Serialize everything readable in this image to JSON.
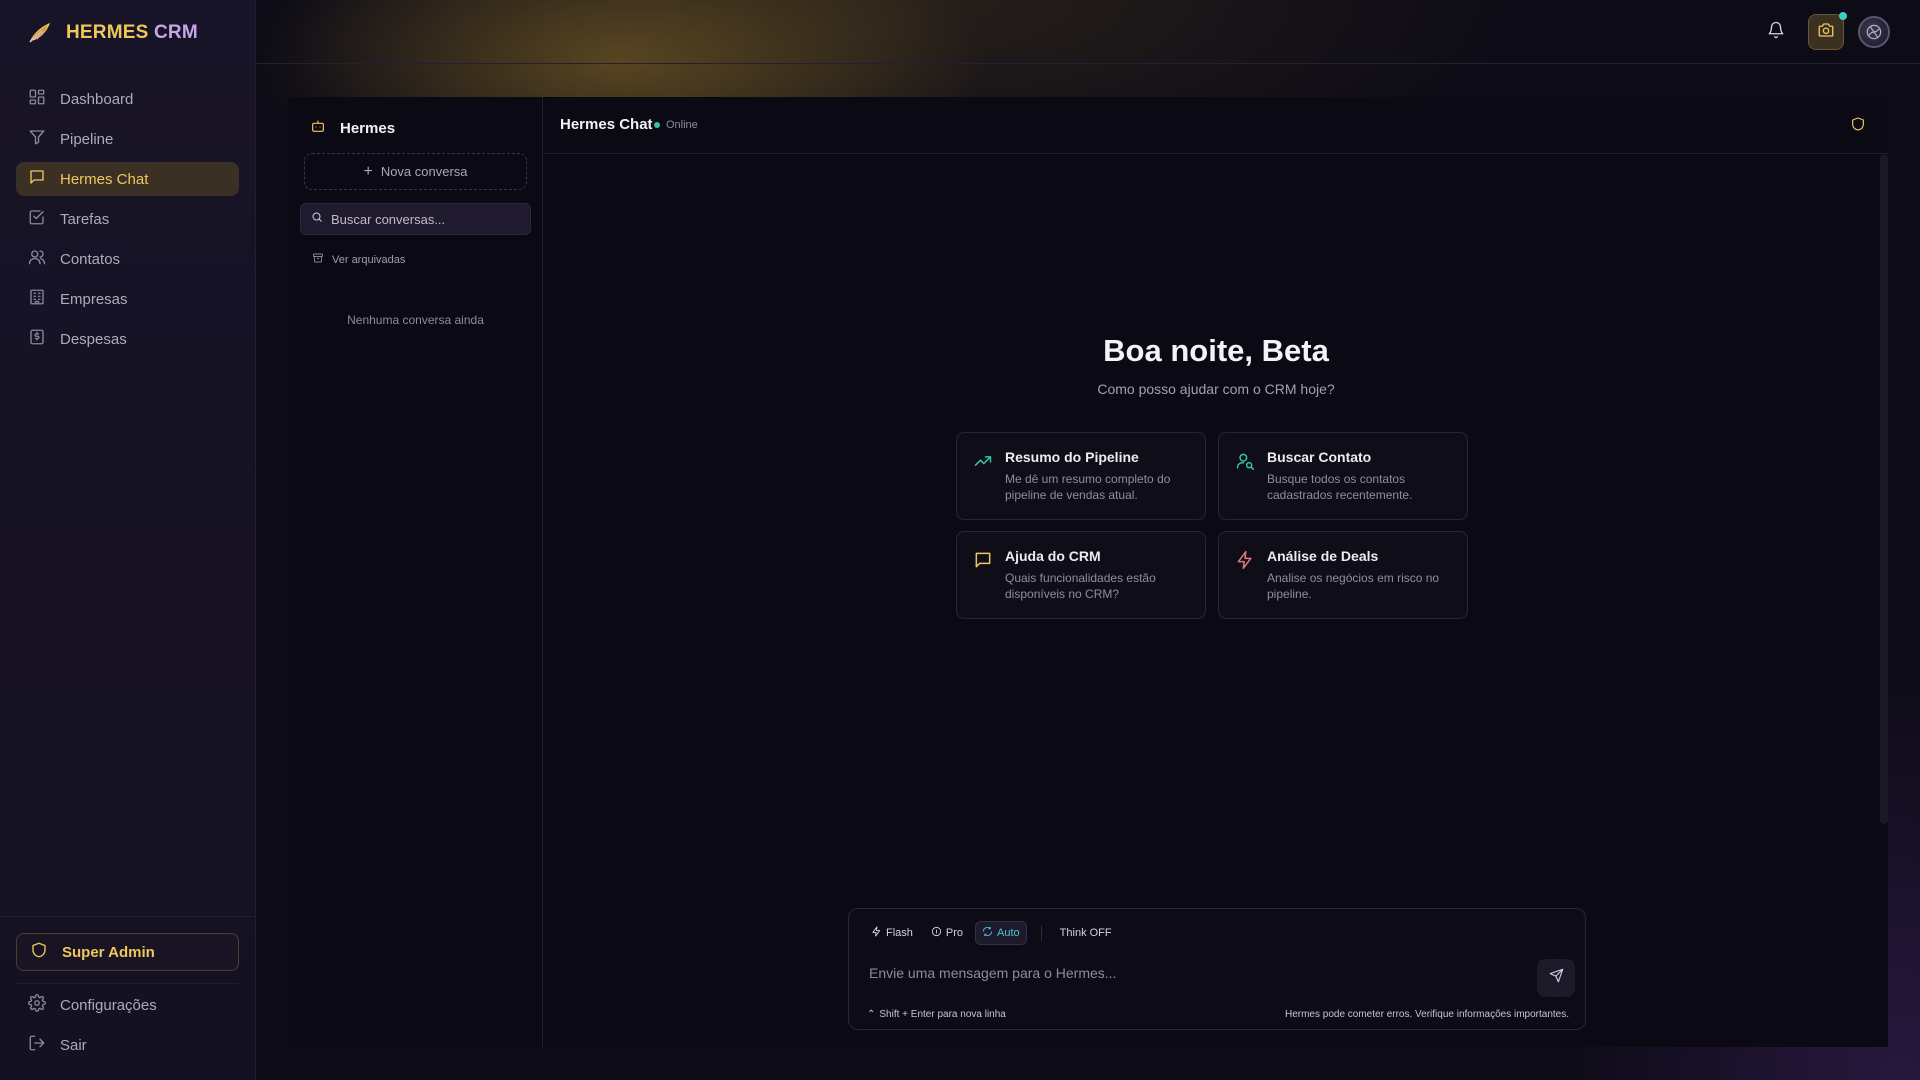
{
  "app": {
    "brand_primary": "HERMES",
    "brand_secondary": "CRM",
    "accent_color": "#f0c75a",
    "status_color": "#34c3a8"
  },
  "sidebar": {
    "items": [
      {
        "label": "Dashboard",
        "icon": "dashboard-icon"
      },
      {
        "label": "Pipeline",
        "icon": "filter-icon"
      },
      {
        "label": "Hermes Chat",
        "icon": "chat-icon",
        "active": true
      },
      {
        "label": "Tarefas",
        "icon": "task-icon"
      },
      {
        "label": "Contatos",
        "icon": "users-icon"
      },
      {
        "label": "Empresas",
        "icon": "building-icon"
      },
      {
        "label": "Despesas",
        "icon": "receipt-icon"
      }
    ],
    "role_badge": "Super Admin",
    "bottom_items": [
      {
        "label": "Configurações",
        "icon": "gear-icon"
      },
      {
        "label": "Sair",
        "icon": "logout-icon"
      }
    ]
  },
  "topbar": {
    "icons": [
      "bell-icon",
      "camera-icon",
      "avatar"
    ]
  },
  "conversations": {
    "title": "Hermes",
    "new_label": "Nova conversa",
    "search_placeholder": "Buscar conversas...",
    "archived_label": "Ver arquivadas",
    "empty_text": "Nenhuma conversa ainda"
  },
  "chat": {
    "title": "Hermes Chat",
    "status": "Online",
    "greeting": "Boa noite, Beta",
    "subtitle": "Como posso ajudar com o CRM hoje?",
    "suggestions": [
      {
        "title": "Resumo do Pipeline",
        "desc": "Me dê um resumo completo do pipeline de vendas atual.",
        "icon": "trending-up-icon"
      },
      {
        "title": "Buscar Contato",
        "desc": "Busque todos os contatos cadastrados recentemente.",
        "icon": "user-search-icon"
      },
      {
        "title": "Ajuda do CRM",
        "desc": "Quais funcionalidades estão disponíveis no CRM?",
        "icon": "message-icon"
      },
      {
        "title": "Análise de Deals",
        "desc": "Analise os negócios em risco no pipeline.",
        "icon": "zap-icon"
      }
    ],
    "composer": {
      "modes": [
        "Flash",
        "Pro",
        "Auto"
      ],
      "active_mode": "Auto",
      "think_label": "Think OFF",
      "placeholder": "Envie uma mensagem para o Hermes...",
      "hint": "Shift + Enter para nova linha",
      "disclaimer": "Hermes pode cometer erros. Verifique informações importantes."
    }
  }
}
